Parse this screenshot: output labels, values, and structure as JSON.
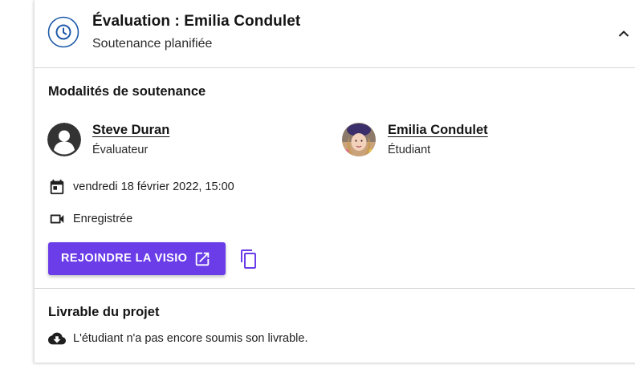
{
  "header": {
    "title": "Évaluation : Emilia Condulet",
    "subtitle": "Soutenance planifiée",
    "icon": "clock-icon",
    "toggle_icon": "chevron-up-icon"
  },
  "modalities": {
    "title": "Modalités de soutenance",
    "evaluator": {
      "name": "Steve Duran",
      "role": "Évaluateur"
    },
    "student": {
      "name": "Emilia Condulet",
      "role": "Étudiant"
    },
    "date": "vendredi 18 février 2022, 15:00",
    "recording": "Enregistrée",
    "join_button_label": "REJOINDRE LA VISIO",
    "join_button_icon": "open-external-icon",
    "copy_icon": "copy-icon"
  },
  "deliverable": {
    "title": "Livrable du projet",
    "status": "L'étudiant n'a pas encore soumis son livrable.",
    "icon": "cloud-download-icon"
  },
  "colors": {
    "accent": "#6a3de8",
    "header_icon": "#1e5aa8",
    "text": "#141414"
  }
}
